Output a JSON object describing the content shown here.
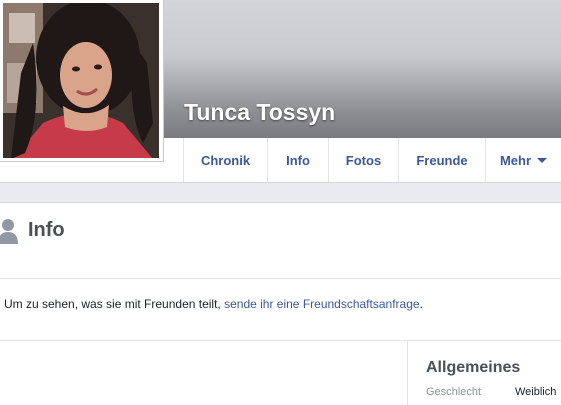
{
  "profile": {
    "name": "Tunca Tossyn"
  },
  "tabs": [
    {
      "label": "Chronik"
    },
    {
      "label": "Info"
    },
    {
      "label": "Fotos"
    },
    {
      "label": "Freunde"
    },
    {
      "label": "Mehr"
    }
  ],
  "section": {
    "title": "Info"
  },
  "message": {
    "prefix": "Um zu sehen, was sie mit Freunden teilt, ",
    "link": "sende ihr eine Freundschaftsanfrage",
    "suffix": "."
  },
  "general": {
    "title": "Allgemeines",
    "gender_label": "Geschlecht",
    "gender_value": "Weiblich"
  },
  "colors": {
    "link": "#3b5998",
    "background": "#e9ebee"
  }
}
